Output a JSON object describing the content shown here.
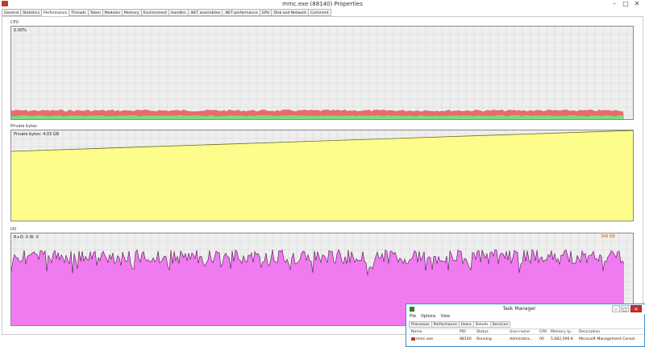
{
  "window": {
    "title": "mmc.exe (88140) Properties",
    "controls": [
      "–",
      "□",
      "✕"
    ]
  },
  "tabs": [
    {
      "label": "General"
    },
    {
      "label": "Statistics"
    },
    {
      "label": "Performance",
      "active": true
    },
    {
      "label": "Threads"
    },
    {
      "label": "Token"
    },
    {
      "label": "Modules"
    },
    {
      "label": "Memory"
    },
    {
      "label": "Environment"
    },
    {
      "label": "Handles"
    },
    {
      "label": ".NET assemblies"
    },
    {
      "label": ".NET performance"
    },
    {
      "label": "GPU"
    },
    {
      "label": "Disk and Network"
    },
    {
      "label": "Comment"
    }
  ],
  "graphs": {
    "cpu": {
      "label": "CPU",
      "value_text": "0.00%",
      "colors": {
        "kernel": "#e96b6b",
        "user": "#7ed87e"
      }
    },
    "private": {
      "label": "Private bytes",
      "value_text": "Private bytes: 4.03 GB",
      "color": "#ffff7a"
    },
    "io": {
      "label": "I/O",
      "value_text": "R+O: 0  W: 0",
      "peak_text": "346 KB",
      "color": "#f07af0"
    }
  },
  "task_manager": {
    "title": "Task Manager",
    "controls": [
      "–",
      "□",
      "✕"
    ],
    "menu": [
      "File",
      "Options",
      "View"
    ],
    "tabs": [
      {
        "label": "Processes"
      },
      {
        "label": "Performance"
      },
      {
        "label": "Users"
      },
      {
        "label": "Details",
        "active": true
      },
      {
        "label": "Services"
      }
    ],
    "columns": [
      "Name",
      "PID",
      "Status",
      "User name",
      "CPU",
      "Memory (p...",
      "Description"
    ],
    "rows": [
      {
        "name": "mmc.exe",
        "pid": "88140",
        "status": "Running",
        "user": "Administra...",
        "cpu": "00",
        "memory": "5,082,596 K",
        "description": "Microsoft Management Consol"
      }
    ]
  }
}
